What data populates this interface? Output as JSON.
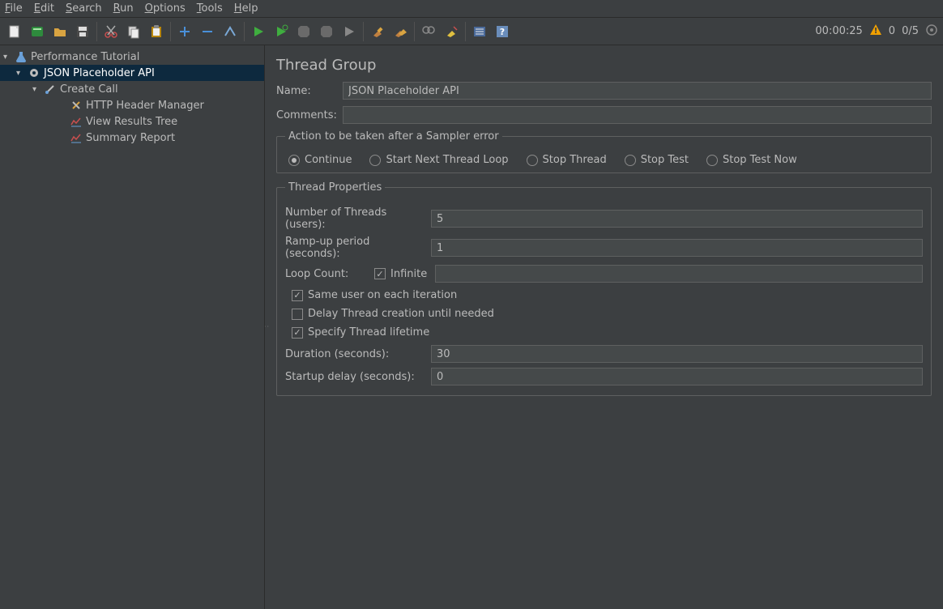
{
  "menu": {
    "file": "File",
    "edit": "Edit",
    "search": "Search",
    "run": "Run",
    "options": "Options",
    "tools": "Tools",
    "help": "Help"
  },
  "status": {
    "elapsed": "00:00:25",
    "errors": "0",
    "threads": "0/5"
  },
  "tree": {
    "root": "Performance Tutorial",
    "threadGroup": "JSON Placeholder API",
    "sampler": "Create Call",
    "children": {
      "header": "HTTP Header Manager",
      "viewResults": "View Results Tree",
      "summary": "Summary Report"
    }
  },
  "panel": {
    "title": "Thread Group",
    "nameLabel": "Name:",
    "nameValue": "JSON Placeholder API",
    "commentsLabel": "Comments:",
    "commentsValue": "",
    "errorAction": {
      "legend": "Action to be taken after a Sampler error",
      "continue": "Continue",
      "nextLoop": "Start Next Thread Loop",
      "stopThread": "Stop Thread",
      "stopTest": "Stop Test",
      "stopTestNow": "Stop Test Now"
    },
    "threadProps": {
      "legend": "Thread Properties",
      "numThreadsLabel": "Number of Threads (users):",
      "numThreadsValue": "5",
      "rampUpLabel": "Ramp-up period (seconds):",
      "rampUpValue": "1",
      "loopCountLabel": "Loop Count:",
      "infiniteLabel": "Infinite",
      "loopCountValue": "",
      "sameUser": "Same user on each iteration",
      "delayCreate": "Delay Thread creation until needed",
      "specifyLifetime": "Specify Thread lifetime",
      "durationLabel": "Duration (seconds):",
      "durationValue": "30",
      "startupDelayLabel": "Startup delay (seconds):",
      "startupDelayValue": "0"
    }
  }
}
